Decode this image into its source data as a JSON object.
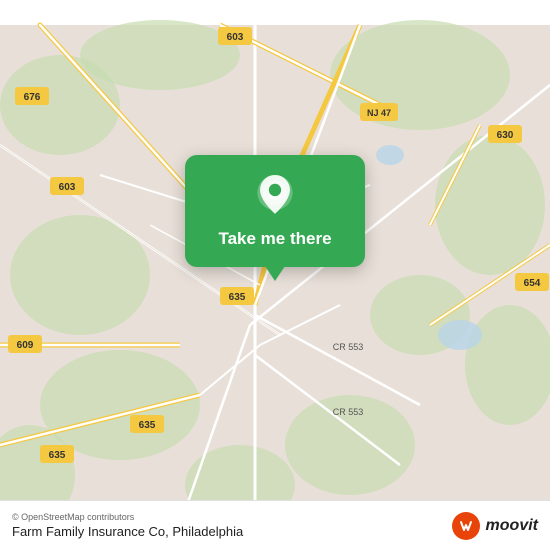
{
  "map": {
    "alt": "Road map showing Farm Family Insurance Co area near Philadelphia"
  },
  "popup": {
    "pin_icon": "location-pin",
    "button_label": "Take me there"
  },
  "bottom_bar": {
    "copyright": "© OpenStreetMap contributors",
    "location_name": "Farm Family Insurance Co, Philadelphia",
    "moovit_text": "moovit"
  },
  "road_labels": {
    "r676": "676",
    "r603_top": "603",
    "r603_left": "603",
    "r47": "NJ 47",
    "r630": "630",
    "r654": "654",
    "r635_mid": "635",
    "r635_bot": "635",
    "r635_bl": "635",
    "r609": "609",
    "r553_top": "CR 553",
    "r553_bot": "CR 553"
  },
  "colors": {
    "map_bg": "#e8e0d8",
    "road_major": "#f5c842",
    "road_minor": "#ffffff",
    "road_gray": "#d4c9b8",
    "green_area": "#c8dbb0",
    "water": "#b0d4e8",
    "popup_green": "#34a853",
    "moovit_red": "#e8440a"
  }
}
